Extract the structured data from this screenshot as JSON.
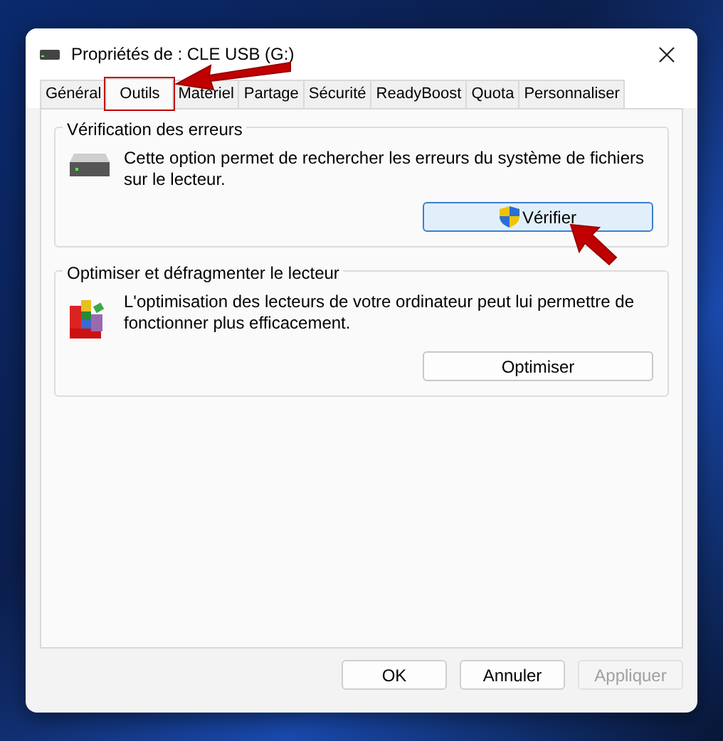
{
  "window": {
    "title": "Propriétés de : CLE USB (G:)"
  },
  "tabs": [
    {
      "label": "Général",
      "selected": false
    },
    {
      "label": "Outils",
      "selected": true
    },
    {
      "label": "Matériel",
      "selected": false
    },
    {
      "label": "Partage",
      "selected": false
    },
    {
      "label": "Sécurité",
      "selected": false
    },
    {
      "label": "ReadyBoost",
      "selected": false
    },
    {
      "label": "Quota",
      "selected": false
    },
    {
      "label": "Personnaliser",
      "selected": false
    }
  ],
  "groups": [
    {
      "title": "Vérification des erreurs",
      "kind": "drive",
      "text": "Cette option permet de rechercher les erreurs du système de fichiers sur le lecteur.",
      "button": {
        "label": "Vérifier",
        "shield": true,
        "focused": true
      }
    },
    {
      "title": "Optimiser et défragmenter le lecteur",
      "kind": "defrag",
      "text": "L'optimisation des lecteurs de votre ordinateur peut lui permettre de fonctionner plus efficacement.",
      "button": {
        "label": "Optimiser",
        "shield": false,
        "focused": false
      }
    }
  ],
  "buttons": [
    {
      "label": "OK",
      "disabled": false
    },
    {
      "label": "Annuler",
      "disabled": false
    },
    {
      "label": "Appliquer",
      "disabled": true
    }
  ]
}
